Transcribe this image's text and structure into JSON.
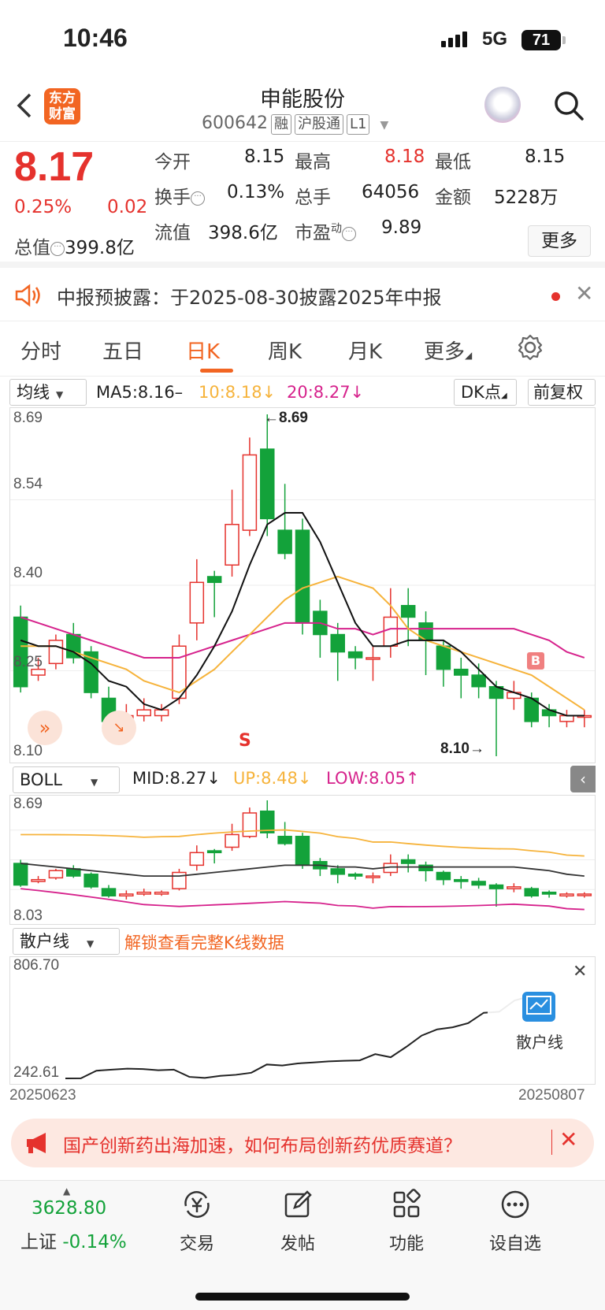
{
  "status": {
    "time": "10:46",
    "network": "5G",
    "battery": "71"
  },
  "header": {
    "logo_line1": "东方",
    "logo_line2": "财富",
    "title": "申能股份",
    "code": "600642",
    "tags": [
      "融",
      "沪股通",
      "L1"
    ]
  },
  "quote": {
    "price": "8.17",
    "pct": "0.25%",
    "change": "0.02",
    "total_cap_label": "总值",
    "total_cap": "399.8亿",
    "open_label": "今开",
    "open": "8.15",
    "high_label": "最高",
    "high": "8.18",
    "low_label": "最低",
    "low": "8.15",
    "turnover_label": "换手",
    "turnover": "0.13%",
    "volume_label": "总手",
    "volume": "64056",
    "amount_label": "金额",
    "amount": "5228万",
    "float_label": "流值",
    "float": "398.6亿",
    "pe_label": "市盈",
    "pe_sup": "动",
    "pe": "9.89",
    "more": "更多"
  },
  "notice": {
    "text": "中报预披露：于2025-08-30披露2025年中报"
  },
  "tabs": [
    "分时",
    "五日",
    "日K",
    "周K",
    "月K",
    "更多"
  ],
  "active_tab": "日K",
  "ma_row": {
    "select": "均线",
    "ma5": "MA5:8.16–",
    "ma10": "10:8.18↓",
    "ma20": "20:8.27↓",
    "dk": "DK点",
    "adjust": "前复权"
  },
  "colors": {
    "up": "#e5322d",
    "down": "#13a23a",
    "ma5": "#111111",
    "ma10": "#f6b33b",
    "ma20": "#d6228c",
    "accent": "#f26522"
  },
  "main_chart": {
    "y_top": "8.69",
    "y_1": "8.54",
    "y_2": "8.40",
    "y_3": "8.25",
    "y_bottom": "8.10",
    "high_mark": "←8.69",
    "low_mark": "8.10→",
    "s_mark": "S",
    "b_mark": "B"
  },
  "boll": {
    "select": "BOLL",
    "mid": "MID:8.27↓",
    "up": "UP:8.48↓",
    "low": "LOW:8.05↑",
    "y_top": "8.69",
    "y_bottom": "8.03"
  },
  "retail": {
    "select": "散户线",
    "unlock": "解锁查看完整K线数据",
    "y_top": "806.70",
    "y_bottom": "242.61",
    "date_start": "20250623",
    "date_end": "20250807",
    "badge": "散户线"
  },
  "ad": {
    "text": "国产创新药出海加速，如何布局创新药优质赛道？"
  },
  "bottom": {
    "index_value": "3628.80",
    "index_name": "上证",
    "index_pct": "-0.14%",
    "items": [
      "交易",
      "发帖",
      "功能",
      "设自选"
    ]
  },
  "chart_data": {
    "type": "candlestick",
    "ylim": [
      8.1,
      8.69
    ],
    "candles": [
      [
        8.34,
        8.22,
        8.36,
        8.21
      ],
      [
        8.24,
        8.25,
        8.27,
        8.23
      ],
      [
        8.26,
        8.3,
        8.31,
        8.25
      ],
      [
        8.31,
        8.27,
        8.33,
        8.26
      ],
      [
        8.28,
        8.21,
        8.29,
        8.2
      ],
      [
        8.2,
        8.16,
        8.22,
        8.15
      ],
      [
        8.16,
        8.17,
        8.19,
        8.14
      ],
      [
        8.17,
        8.18,
        8.2,
        8.16
      ],
      [
        8.17,
        8.18,
        8.19,
        8.16
      ],
      [
        8.2,
        8.29,
        8.31,
        8.19
      ],
      [
        8.33,
        8.4,
        8.44,
        8.3
      ],
      [
        8.41,
        8.4,
        8.42,
        8.34
      ],
      [
        8.43,
        8.5,
        8.56,
        8.41
      ],
      [
        8.49,
        8.62,
        8.65,
        8.48
      ],
      [
        8.63,
        8.51,
        8.69,
        8.48
      ],
      [
        8.49,
        8.45,
        8.57,
        8.44
      ],
      [
        8.49,
        8.33,
        8.51,
        8.31
      ],
      [
        8.35,
        8.31,
        8.37,
        8.27
      ],
      [
        8.31,
        8.28,
        8.33,
        8.23
      ],
      [
        8.28,
        8.27,
        8.29,
        8.25
      ],
      [
        8.27,
        8.27,
        8.29,
        8.23
      ],
      [
        8.29,
        8.34,
        8.39,
        8.27
      ],
      [
        8.36,
        8.34,
        8.39,
        8.29
      ],
      [
        8.33,
        8.3,
        8.35,
        8.24
      ],
      [
        8.29,
        8.25,
        8.3,
        8.22
      ],
      [
        8.25,
        8.24,
        8.27,
        8.2
      ],
      [
        8.24,
        8.22,
        8.26,
        8.2
      ],
      [
        8.22,
        8.2,
        8.23,
        8.1
      ],
      [
        8.2,
        8.21,
        8.23,
        8.18
      ],
      [
        8.2,
        8.16,
        8.21,
        8.15
      ],
      [
        8.18,
        8.17,
        8.19,
        8.15
      ],
      [
        8.16,
        8.17,
        8.18,
        8.15
      ],
      [
        8.17,
        8.17,
        8.18,
        8.15
      ]
    ],
    "ma5": [
      8.3,
      8.29,
      8.29,
      8.28,
      8.26,
      8.23,
      8.22,
      8.19,
      8.18,
      8.2,
      8.24,
      8.29,
      8.35,
      8.43,
      8.5,
      8.52,
      8.52,
      8.47,
      8.4,
      8.33,
      8.29,
      8.29,
      8.3,
      8.3,
      8.3,
      8.28,
      8.25,
      8.22,
      8.21,
      8.2,
      8.18,
      8.17,
      8.17
    ],
    "ma10": [
      8.29,
      8.29,
      8.29,
      8.28,
      8.27,
      8.26,
      8.25,
      8.23,
      8.22,
      8.21,
      8.23,
      8.25,
      8.28,
      8.31,
      8.34,
      8.37,
      8.39,
      8.4,
      8.41,
      8.4,
      8.39,
      8.36,
      8.32,
      8.3,
      8.29,
      8.28,
      8.27,
      8.26,
      8.25,
      8.24,
      8.22,
      8.2,
      8.18
    ],
    "ma20": [
      8.34,
      8.33,
      8.32,
      8.31,
      8.3,
      8.29,
      8.28,
      8.27,
      8.27,
      8.27,
      8.28,
      8.29,
      8.3,
      8.31,
      8.32,
      8.33,
      8.33,
      8.33,
      8.32,
      8.32,
      8.31,
      8.32,
      8.32,
      8.32,
      8.32,
      8.32,
      8.32,
      8.32,
      8.32,
      8.31,
      8.3,
      8.28,
      8.27
    ],
    "retail_line": [
      242.61,
      243,
      280,
      285,
      290,
      288,
      282,
      285,
      250,
      245,
      255,
      260,
      270,
      310,
      305,
      315,
      320,
      325,
      328,
      330,
      360,
      345,
      395,
      450,
      480,
      490,
      510,
      560,
      565,
      620,
      640
    ]
  }
}
